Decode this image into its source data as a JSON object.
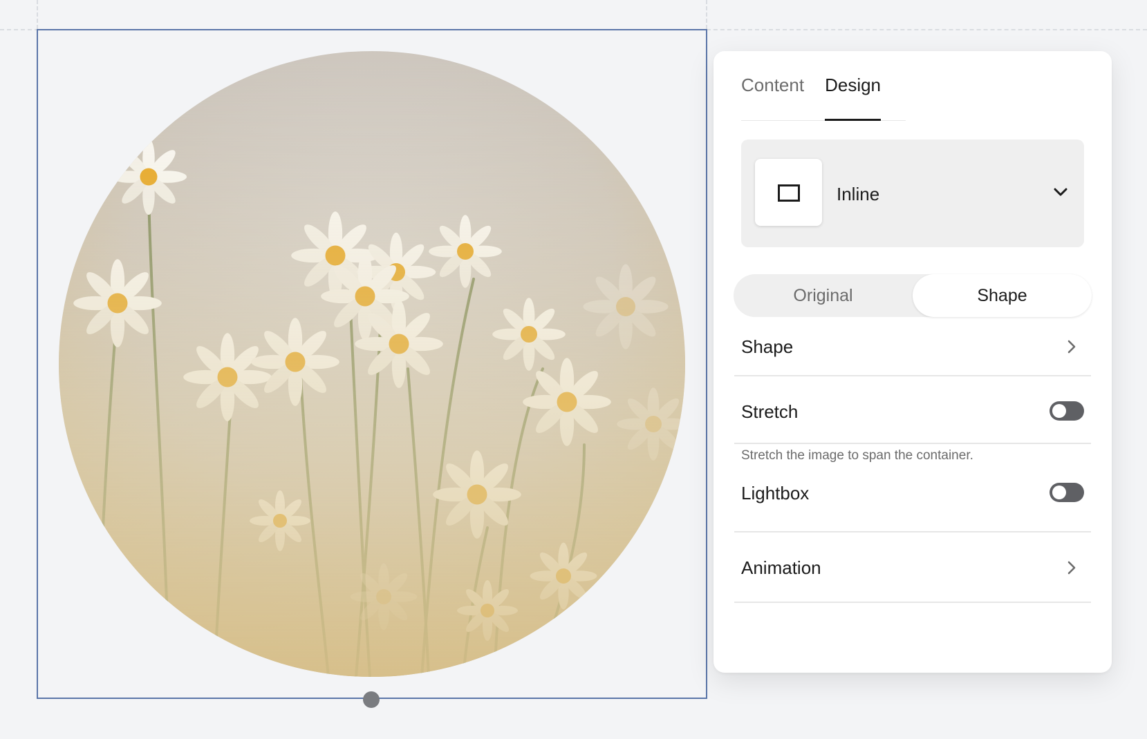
{
  "image_block": {
    "photo_description_icon": "daisy-photo-circle"
  },
  "panel": {
    "tabs": [
      {
        "label": "Content",
        "active": false
      },
      {
        "label": "Design",
        "active": true
      }
    ],
    "layout": {
      "label": "Inline",
      "icon": "inline-layout-icon"
    },
    "aspect": {
      "options": [
        "Original",
        "Shape"
      ],
      "selected": "Shape"
    },
    "rows": {
      "shape": {
        "label": "Shape"
      },
      "stretch": {
        "label": "Stretch",
        "enabled": false,
        "helper": "Stretch the image to span the container."
      },
      "lightbox": {
        "label": "Lightbox",
        "enabled": false
      },
      "animation": {
        "label": "Animation"
      }
    }
  }
}
